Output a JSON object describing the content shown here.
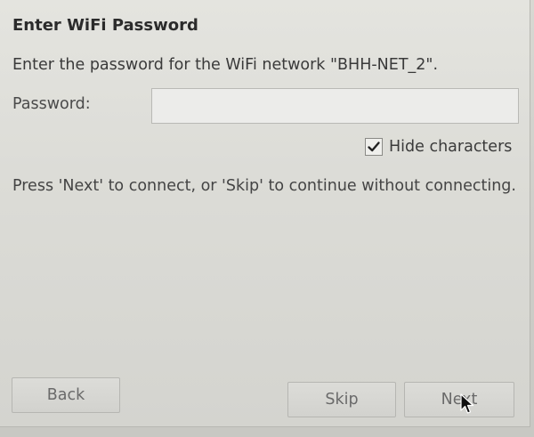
{
  "dialog": {
    "title": "Enter WiFi Password",
    "prompt": "Enter the password for the WiFi network \"BHH-NET_2\".",
    "password_label": "Password:",
    "password_value": "",
    "hide_characters_label": "Hide characters",
    "hide_characters_checked": true,
    "hint": "Press 'Next' to connect, or 'Skip' to continue without connecting."
  },
  "buttons": {
    "back": "Back",
    "skip": "Skip",
    "next": "Next"
  },
  "icons": {
    "checkbox": "checkmark-icon",
    "cursor": "mouse-pointer-icon"
  },
  "colors": {
    "background": "#dcdcd7",
    "text": "#3a3a3a",
    "button_text": "#6a6a6a"
  }
}
